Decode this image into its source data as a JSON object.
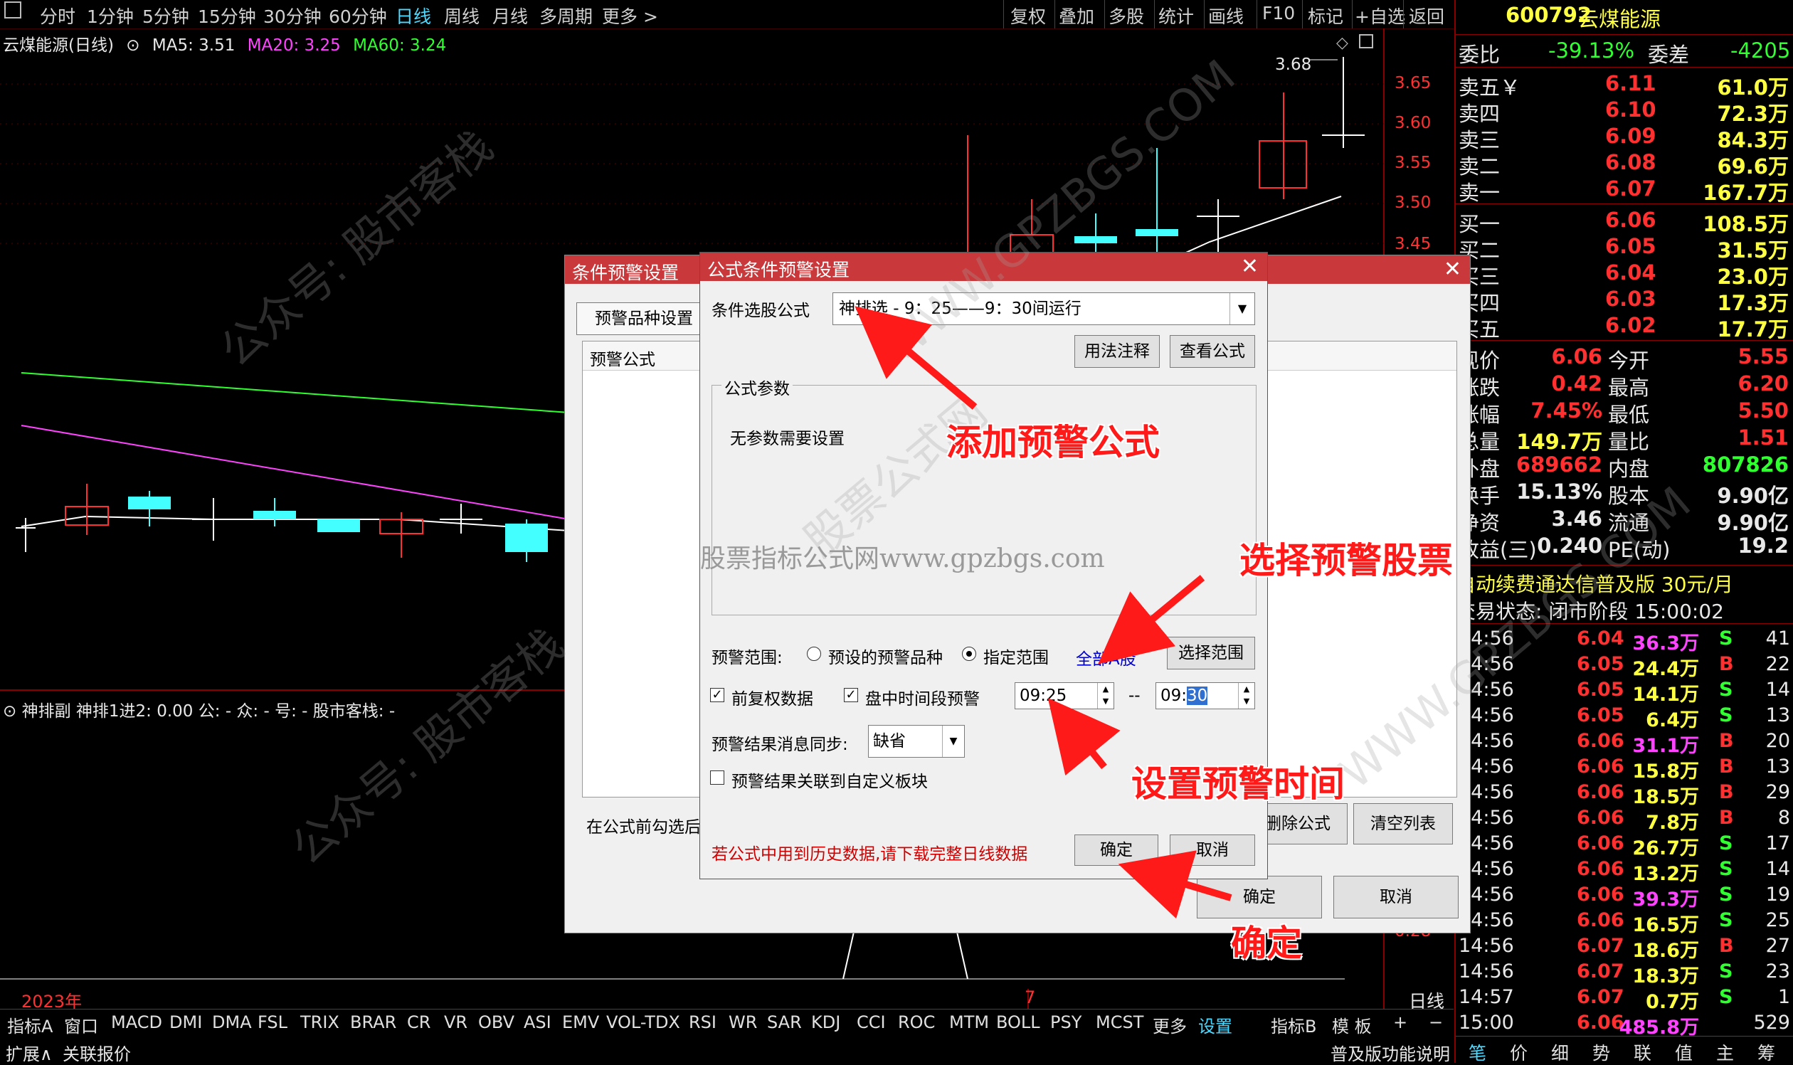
{
  "toolbar": {
    "left": [
      "分时",
      "1分钟",
      "5分钟",
      "15分钟",
      "30分钟",
      "60分钟",
      "日线",
      "周线",
      "月线",
      "多周期",
      "更多 >"
    ],
    "right": [
      "复权",
      "叠加",
      "多股",
      "统计",
      "画线",
      "F10",
      "标记",
      "+自选",
      "返回"
    ]
  },
  "chart": {
    "title": "云煤能源(日线)",
    "ma5": "MA5: 3.51",
    "ma20": "MA20: 3.25",
    "ma60": "MA60: 3.24",
    "high_label": "3.68",
    "y_ticks": [
      "3.65",
      "3.60",
      "3.55",
      "3.50",
      "3.45"
    ],
    "indicator": "神排副  神排1进2: 0.00  公: -  众: -  号: -  股市客栈: -",
    "year": "2023年",
    "month": "7",
    "period": "日线",
    "lower_tick": "0.28",
    "colors": {
      "up": "#ff3030",
      "down": "#44ffff",
      "ma5": "#ffffff",
      "ma20": "#ff44ff",
      "ma60": "#30ff30"
    }
  },
  "quote": {
    "code": "600792",
    "name": "云煤能源",
    "weibi_label": "委比",
    "weibi": "-39.13%",
    "weicha_label": "委差",
    "weicha": "-4205",
    "asks": [
      {
        "label": "卖五￥",
        "price": "6.11",
        "vol": "61.0万"
      },
      {
        "label": "卖四",
        "price": "6.10",
        "vol": "72.3万"
      },
      {
        "label": "卖三",
        "price": "6.09",
        "vol": "84.3万"
      },
      {
        "label": "卖二",
        "price": "6.08",
        "vol": "69.6万"
      },
      {
        "label": "卖一",
        "price": "6.07",
        "vol": "167.7万"
      }
    ],
    "bids": [
      {
        "label": "买一",
        "price": "6.06",
        "vol": "108.5万"
      },
      {
        "label": "买二",
        "price": "6.05",
        "vol": "31.5万"
      },
      {
        "label": "买三",
        "price": "6.04",
        "vol": "23.0万"
      },
      {
        "label": "买四",
        "price": "6.03",
        "vol": "17.3万"
      },
      {
        "label": "买五",
        "price": "6.02",
        "vol": "17.7万"
      }
    ],
    "stats": [
      {
        "l1": "现价",
        "v1": "6.06",
        "l2": "今开",
        "v2": "5.55"
      },
      {
        "l1": "涨跌",
        "v1": "0.42",
        "l2": "最高",
        "v2": "6.20"
      },
      {
        "l1": "涨幅",
        "v1": "7.45%",
        "l2": "最低",
        "v2": "5.50"
      },
      {
        "l1": "总量",
        "v1": "149.7万",
        "l2": "量比",
        "v2": "1.51"
      },
      {
        "l1": "外盘",
        "v1": "689662",
        "l2": "内盘",
        "v2": "807826"
      },
      {
        "l1": "换手",
        "v1": "15.13%",
        "l2": "股本",
        "v2": "9.90亿"
      },
      {
        "l1": "净资",
        "v1": "3.46",
        "l2": "流通",
        "v2": "9.90亿"
      },
      {
        "l1": "收益(三)",
        "v1": "0.240",
        "l2": "PE(动)",
        "v2": "19.2"
      }
    ],
    "promo": "自动续费通达信普及版  30元/月",
    "trade_status": "交易状态: 闭市阶段 15:00:02",
    "ticks": [
      {
        "t": "14:56",
        "p": "6.04",
        "v": "36.3万",
        "s": "S",
        "n": "41"
      },
      {
        "t": "14:56",
        "p": "6.05",
        "v": "24.4万",
        "s": "B",
        "n": "22"
      },
      {
        "t": "14:56",
        "p": "6.05",
        "v": "14.1万",
        "s": "S",
        "n": "14"
      },
      {
        "t": "14:56",
        "p": "6.05",
        "v": "6.4万",
        "s": "S",
        "n": "13"
      },
      {
        "t": "14:56",
        "p": "6.06",
        "v": "31.1万",
        "s": "B",
        "n": "20"
      },
      {
        "t": "14:56",
        "p": "6.06",
        "v": "15.8万",
        "s": "B",
        "n": "13"
      },
      {
        "t": "14:56",
        "p": "6.06",
        "v": "18.5万",
        "s": "B",
        "n": "29"
      },
      {
        "t": "14:56",
        "p": "6.06",
        "v": "7.8万",
        "s": "B",
        "n": "8"
      },
      {
        "t": "14:56",
        "p": "6.06",
        "v": "26.7万",
        "s": "S",
        "n": "17"
      },
      {
        "t": "14:56",
        "p": "6.06",
        "v": "13.2万",
        "s": "S",
        "n": "14"
      },
      {
        "t": "14:56",
        "p": "6.06",
        "v": "39.3万",
        "s": "S",
        "n": "19"
      },
      {
        "t": "14:56",
        "p": "6.06",
        "v": "16.5万",
        "s": "S",
        "n": "25"
      },
      {
        "t": "14:56",
        "p": "6.07",
        "v": "18.6万",
        "s": "B",
        "n": "27"
      },
      {
        "t": "14:56",
        "p": "6.07",
        "v": "18.3万",
        "s": "S",
        "n": "23"
      },
      {
        "t": "14:57",
        "p": "6.07",
        "v": "0.7万",
        "s": "S",
        "n": "1"
      },
      {
        "t": "15:00",
        "p": "6.06",
        "v": "485.8万",
        "s": "",
        "n": "529"
      }
    ],
    "bottom_tabs": [
      "笔",
      "价",
      "细",
      "势",
      "联",
      "值",
      "主",
      "筹"
    ]
  },
  "bottom_tabs": [
    "指标A",
    "窗口",
    "MACD",
    "DMI",
    "DMA",
    "FSL",
    "TRIX",
    "BRAR",
    "CR",
    "VR",
    "OBV",
    "ASI",
    "EMV",
    "VOL-TDX",
    "RSI",
    "WR",
    "SAR",
    "KDJ",
    "CCI",
    "ROC",
    "MTM",
    "BOLL",
    "PSY",
    "MCST",
    "更多",
    "设置",
    "指标B",
    "模 板",
    "+",
    "−"
  ],
  "status": {
    "left1": "扩展∧",
    "left2": "关联报价",
    "right": "普及版功能说明"
  },
  "outer_dialog": {
    "title": "条件预警设置",
    "tab": "预警品种设置",
    "list_header": "预警公式",
    "hint": "在公式前勾选后",
    "delete_btn": "删除公式",
    "clear_btn": "清空列表",
    "ok": "确定",
    "cancel": "取消"
  },
  "dialog": {
    "title": "公式条件预警设置",
    "formula_label": "条件选股公式",
    "formula_value": "神排选 - 9：25——9：30间运行",
    "usage_btn": "用法注释",
    "view_btn": "查看公式",
    "params_group": "公式参数",
    "params_text": "无参数需要设置",
    "range_label": "预警范围:",
    "radio1": "预设的预警品种",
    "radio2": "指定范围",
    "range_link": "全部A股",
    "select_range_btn": "选择范围",
    "chk_adjust": "前复权数据",
    "chk_timeslot": "盘中时间段预警",
    "time_from": "09:25",
    "time_sep": "--",
    "time_to_h": "09:",
    "time_to_m": "30",
    "sync_label": "预警结果消息同步:",
    "sync_value": "缺省",
    "chk_link": "预警结果关联到自定义板块",
    "warn_text": "若公式中用到历史数据,请下载完整日线数据",
    "ok": "确定",
    "cancel": "取消"
  },
  "annotations": {
    "add_formula": "添加预警公式",
    "select_stocks": "选择预警股票",
    "set_time": "设置预警时间",
    "confirm": "确定",
    "site": "股票指标公式网www.gpzbgs.com"
  },
  "watermarks": [
    "公众号: 股市客栈",
    "公众号: 股市客栈",
    "WWW.GPZBGS.COM",
    "股票公式网",
    "WWW.GPZBGS.COM"
  ]
}
